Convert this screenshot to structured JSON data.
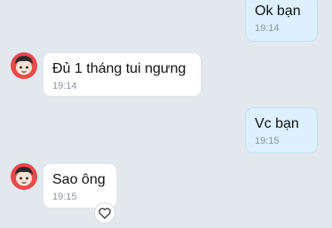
{
  "messages": [
    {
      "direction": "out",
      "text": "Ok bạn",
      "time": "19:14"
    },
    {
      "direction": "in",
      "text": "Đủ 1 tháng tui ngưng",
      "time": "19:14"
    },
    {
      "direction": "out",
      "text": "Vc bạn",
      "time": "19:15"
    },
    {
      "direction": "in",
      "text": "Sao ông",
      "time": "19:15"
    }
  ],
  "icons": {
    "avatar": "user-avatar-icon",
    "react": "heart-outline-icon"
  },
  "colors": {
    "background": "#e3e8ef",
    "outgoing_bubble": "#dcf0fd",
    "incoming_bubble": "#ffffff",
    "timestamp": "#8a95a0"
  }
}
